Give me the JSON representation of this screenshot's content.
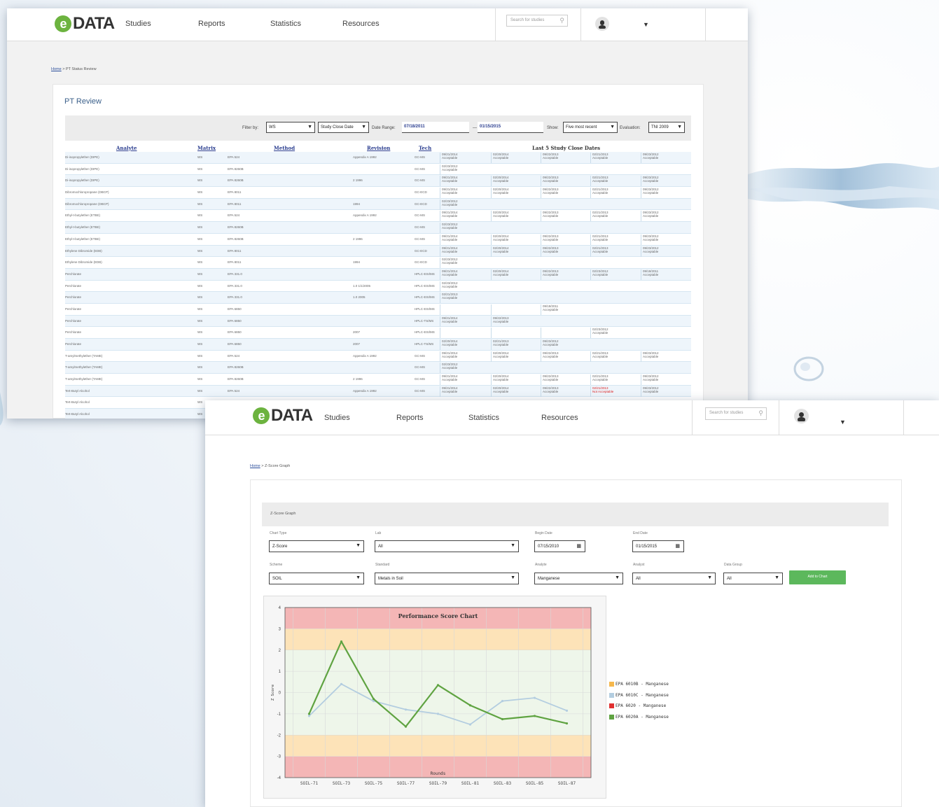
{
  "app": {
    "logo_text": "DATA",
    "nav": [
      "Studies",
      "Reports",
      "Statistics",
      "Resources"
    ],
    "search_placeholder": "Search for studies"
  },
  "pt_review": {
    "breadcrumb": {
      "home": "Home",
      "separator": " > ",
      "current": "PT Status Review"
    },
    "title": "PT Review",
    "filters": {
      "filter_by_label": "Filter by:",
      "filter_by_value": "WS",
      "date_field_value": "Study Close Date",
      "date_range_label": "Date Range:",
      "date_from": "07/18/2011",
      "date_sep": "—",
      "date_to": "01/15/2015",
      "show_label": "Show:",
      "show_value": "Five most recent",
      "evaluation_label": "Evaluation:",
      "evaluation_value": "TNI 2009"
    },
    "columns": [
      "Analyte",
      "Matrix",
      "Method",
      "Revision",
      "Tech",
      "Last 5 Study Close Dates"
    ],
    "rows": [
      {
        "analyte": "Di-isopropylether (DIPE)",
        "matrix": "WS",
        "method": "EPA 524",
        "revision": "Appendix A 1992",
        "tech": "GC-MS",
        "dates": [
          "09/21/2014\nAcceptable",
          "02/20/2014\nAcceptable",
          "09/22/2013\nAcceptable",
          "02/21/2013\nAcceptable",
          "09/23/2012\nAcceptable"
        ]
      },
      {
        "analyte": "Di-isopropylether (DIPE)",
        "matrix": "WS",
        "method": "EPA 8260B",
        "revision": "",
        "tech": "GC-MS",
        "dates": [
          "02/23/2012\nAcceptable"
        ]
      },
      {
        "analyte": "Di-isopropylether (DIPE)",
        "matrix": "WS",
        "method": "EPA 8260B",
        "revision": "2 1996",
        "tech": "GC-MS",
        "dates": [
          "09/21/2014\nAcceptable",
          "02/20/2014\nAcceptable",
          "09/22/2013\nAcceptable",
          "02/21/2013\nAcceptable",
          "09/23/2012\nAcceptable"
        ]
      },
      {
        "analyte": "Dibromochloropropane (DBCP)",
        "matrix": "WS",
        "method": "EPA 8011",
        "revision": "",
        "tech": "GC-ECD",
        "dates": [
          "09/21/2014\nAcceptable",
          "02/20/2014\nAcceptable",
          "09/22/2013\nAcceptable",
          "02/21/2013\nAcceptable",
          "09/23/2012\nAcceptable"
        ]
      },
      {
        "analyte": "Dibromochloropropane (DBCP)",
        "matrix": "WS",
        "method": "EPA 8011",
        "revision": "1994",
        "tech": "GC-ECD",
        "dates": [
          "02/23/2012\nAcceptable"
        ]
      },
      {
        "analyte": "Ethyl-t-butylether (ETBE)",
        "matrix": "WS",
        "method": "EPA 524",
        "revision": "Appendix A 1992",
        "tech": "GC-MS",
        "dates": [
          "09/21/2014\nAcceptable",
          "02/20/2014\nAcceptable",
          "09/22/2013\nAcceptable",
          "02/21/2013\nAcceptable",
          "09/23/2012\nAcceptable"
        ]
      },
      {
        "analyte": "Ethyl-t-butylether (ETBE)",
        "matrix": "WS",
        "method": "EPA 8260B",
        "revision": "",
        "tech": "GC-MS",
        "dates": [
          "02/23/2012\nAcceptable"
        ]
      },
      {
        "analyte": "Ethyl-t-butylether (ETBE)",
        "matrix": "WS",
        "method": "EPA 8260B",
        "revision": "2 1996",
        "tech": "GC-MS",
        "dates": [
          "09/21/2014\nAcceptable",
          "02/20/2014\nAcceptable",
          "09/22/2013\nAcceptable",
          "02/21/2013\nAcceptable",
          "09/23/2012\nAcceptable"
        ]
      },
      {
        "analyte": "Ethylene Dibromide (EDB)",
        "matrix": "WS",
        "method": "EPA 8011",
        "revision": "",
        "tech": "GC-ECD",
        "dates": [
          "09/21/2014\nAcceptable",
          "02/20/2014\nAcceptable",
          "09/22/2013\nAcceptable",
          "02/21/2013\nAcceptable",
          "09/23/2012\nAcceptable"
        ]
      },
      {
        "analyte": "Ethylene Dibromide (EDB)",
        "matrix": "WS",
        "method": "EPA 8011",
        "revision": "1994",
        "tech": "GC-ECD",
        "dates": [
          "02/23/2012\nAcceptable"
        ]
      },
      {
        "analyte": "Perchlorate",
        "matrix": "WS",
        "method": "EPA 331.0",
        "revision": "",
        "tech": "HPLC-ESI/MS",
        "dates": [
          "09/21/2014\nAcceptable",
          "02/20/2014\nAcceptable",
          "09/22/2013\nAcceptable",
          "02/23/2012\nAcceptable",
          "09/18/2011\nAcceptable"
        ]
      },
      {
        "analyte": "Perchlorate",
        "matrix": "WS",
        "method": "EPA 331.0",
        "revision": "1.0 1/1/2005",
        "tech": "HPLC-ESI/MS",
        "dates": [
          "02/23/2012\nAcceptable"
        ]
      },
      {
        "analyte": "Perchlorate",
        "matrix": "WS",
        "method": "EPA 331.0",
        "revision": "1.0 2005",
        "tech": "HPLC-ESI/MS",
        "dates": [
          "02/21/2013\nAcceptable"
        ]
      },
      {
        "analyte": "Perchlorate",
        "matrix": "WS",
        "method": "EPA 6850",
        "revision": "",
        "tech": "HPLC-ESI/MS",
        "dates": [
          "",
          "",
          "09/18/2011\nAcceptable"
        ]
      },
      {
        "analyte": "Perchlorate",
        "matrix": "WS",
        "method": "EPA 6850",
        "revision": "",
        "tech": "HPLC-TS/MS",
        "dates": [
          "09/21/2014\nAcceptable",
          "09/22/2013\nAcceptable"
        ]
      },
      {
        "analyte": "Perchlorate",
        "matrix": "WS",
        "method": "EPA 6850",
        "revision": "2007",
        "tech": "HPLC-ESI/MS",
        "dates": [
          "",
          "",
          "",
          "02/23/2012\nAcceptable"
        ]
      },
      {
        "analyte": "Perchlorate",
        "matrix": "WS",
        "method": "EPA 6850",
        "revision": "2007",
        "tech": "HPLC-TS/MS",
        "dates": [
          "02/20/2014\nAcceptable",
          "02/21/2013\nAcceptable",
          "09/23/2012\nAcceptable"
        ]
      },
      {
        "analyte": "T-amylmethylether (TAME)",
        "matrix": "WS",
        "method": "EPA 524",
        "revision": "Appendix A 1992",
        "tech": "GC-MS",
        "dates": [
          "09/21/2014\nAcceptable",
          "02/20/2014\nAcceptable",
          "09/22/2013\nAcceptable",
          "02/21/2013\nAcceptable",
          "09/23/2012\nAcceptable"
        ]
      },
      {
        "analyte": "T-amylmethylether (TAME)",
        "matrix": "WS",
        "method": "EPA 8260B",
        "revision": "",
        "tech": "GC-MS",
        "dates": [
          "02/23/2012\nAcceptable"
        ]
      },
      {
        "analyte": "T-amylmethylether (TAME)",
        "matrix": "WS",
        "method": "EPA 8260B",
        "revision": "2 1996",
        "tech": "GC-MS",
        "dates": [
          "09/21/2014\nAcceptable",
          "02/20/2014\nAcceptable",
          "09/22/2013\nAcceptable",
          "02/21/2013\nAcceptable",
          "09/23/2012\nAcceptable"
        ]
      },
      {
        "analyte": "Tert-Butyl Alcohol",
        "matrix": "WS",
        "method": "EPA 524",
        "revision": "Appendix A 1992",
        "tech": "GC-MS",
        "dates": [
          "09/21/2014\nAcceptable",
          "02/20/2014\nAcceptable",
          "09/22/2013\nAcceptable",
          "02/21/2013\nNot Acceptable",
          "09/23/2012\nAcceptable"
        ]
      },
      {
        "analyte": "Tert-Butyl Alcohol",
        "matrix": "WS",
        "method": "",
        "revision": "",
        "tech": "",
        "dates": []
      },
      {
        "analyte": "Tert-Butyl Alcohol",
        "matrix": "WS",
        "method": "",
        "revision": "",
        "tech": "",
        "dates": []
      }
    ]
  },
  "zscore": {
    "breadcrumb": {
      "home": "Home",
      "separator": " > ",
      "current": "Z-Score Graph"
    },
    "panel_title": "Z-Score Graph",
    "fields": {
      "chart_type": {
        "label": "Chart Type",
        "value": "Z-Score"
      },
      "lab": {
        "label": "Lab",
        "value": "All"
      },
      "begin_date": {
        "label": "Begin Date",
        "value": "07/15/2010"
      },
      "end_date": {
        "label": "End Date",
        "value": "01/15/2015"
      },
      "scheme": {
        "label": "Scheme",
        "value": "SOIL"
      },
      "standard": {
        "label": "Standard",
        "value": "Metals in Soil"
      },
      "analyte": {
        "label": "Analyte",
        "value": "Manganese"
      },
      "analyst": {
        "label": "Analyst",
        "value": "All"
      },
      "data_group": {
        "label": "Data Group",
        "value": "All"
      }
    },
    "add_button": "Add to Chart"
  },
  "chart_data": {
    "type": "line",
    "title": "Performance Score Chart",
    "xlabel": "Rounds",
    "ylabel": "Z Score",
    "categories": [
      "SOIL-71",
      "SOIL-73",
      "SOIL-75",
      "SOIL-77",
      "SOIL-79",
      "SOIL-81",
      "SOIL-83",
      "SOIL-85",
      "SOIL-87"
    ],
    "ylim": [
      -4,
      4
    ],
    "yticks": [
      -4,
      -3,
      -2,
      -1,
      0,
      1,
      2,
      3,
      4
    ],
    "bands": [
      {
        "from": 3,
        "to": 4,
        "color": "#f4b6b6"
      },
      {
        "from": 2,
        "to": 3,
        "color": "#fde3b8"
      },
      {
        "from": -2,
        "to": 2,
        "color": "#eef6ea"
      },
      {
        "from": -3,
        "to": -2,
        "color": "#fde3b8"
      },
      {
        "from": -4,
        "to": -3,
        "color": "#f4b6b6"
      }
    ],
    "grid": true,
    "legend_position": "right",
    "series": [
      {
        "name": "EPA 6010B - Manganese",
        "color": "#f5b74d",
        "x": [],
        "values": []
      },
      {
        "name": "EPA 6010C - Manganese",
        "color": "#b3cde0",
        "x": [
          0,
          1,
          2,
          3,
          4,
          5,
          6,
          7,
          8
        ],
        "values": [
          -1.1,
          0.4,
          -0.4,
          -0.8,
          -1.0,
          -1.5,
          -0.4,
          -0.25,
          -0.85
        ]
      },
      {
        "name": "EPA 6020 - Manganese",
        "color": "#e03030",
        "x": [],
        "values": []
      },
      {
        "name": "EPA 6020A - Manganese",
        "color": "#5fa341",
        "x": [
          0,
          1,
          2,
          3,
          4,
          5,
          6,
          7,
          8
        ],
        "values": [
          -1.0,
          2.4,
          -0.3,
          -1.6,
          0.35,
          -0.6,
          -1.25,
          -1.1,
          -1.45
        ]
      }
    ]
  }
}
